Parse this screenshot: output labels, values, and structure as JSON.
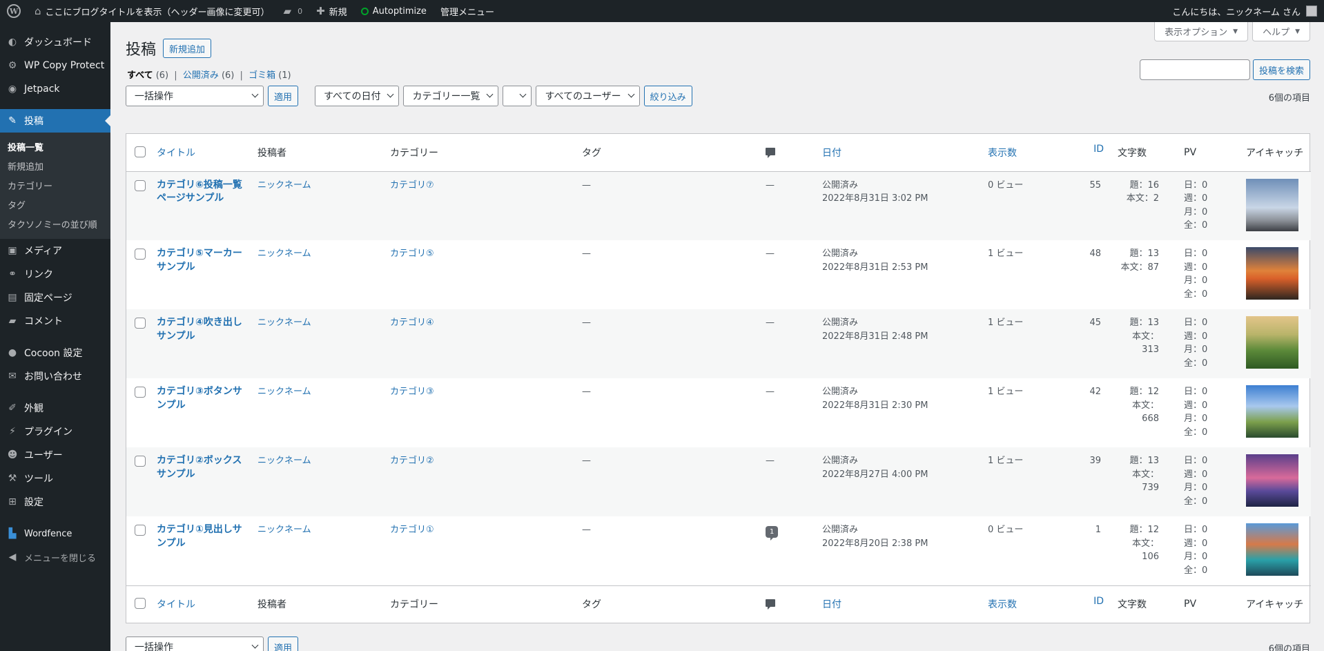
{
  "adminbar": {
    "site_title": "ここにブログタイトルを表示（ヘッダー画像に変更可）",
    "comments_count": "0",
    "new_label": "新規",
    "autoptimize_label": "Autoptimize",
    "admin_menu_label": "管理メニュー",
    "greeting": "こんにちは、ニックネーム さん"
  },
  "sidebar": {
    "items": [
      {
        "label": "ダッシュボード",
        "icon": "dashboard-icon"
      },
      {
        "label": "WP Copy Protect",
        "icon": "gear-icon"
      },
      {
        "label": "Jetpack",
        "icon": "jetpack-icon"
      },
      {
        "label": "投稿",
        "icon": "pin-icon"
      },
      {
        "label": "メディア",
        "icon": "media-icon"
      },
      {
        "label": "リンク",
        "icon": "link-icon"
      },
      {
        "label": "固定ページ",
        "icon": "page-icon"
      },
      {
        "label": "コメント",
        "icon": "comment-icon"
      },
      {
        "label": "Cocoon 設定",
        "icon": "cocoon-icon"
      },
      {
        "label": "お問い合わせ",
        "icon": "mail-icon"
      },
      {
        "label": "外観",
        "icon": "brush-icon"
      },
      {
        "label": "プラグイン",
        "icon": "plugin-icon"
      },
      {
        "label": "ユーザー",
        "icon": "user-icon"
      },
      {
        "label": "ツール",
        "icon": "wrench-icon"
      },
      {
        "label": "設定",
        "icon": "settings-icon"
      },
      {
        "label": "Wordfence",
        "icon": "wordfence-icon"
      },
      {
        "label": "メニューを閉じる",
        "icon": "collapse-icon"
      }
    ],
    "submenu": [
      "投稿一覧",
      "新規追加",
      "カテゴリー",
      "タグ",
      "タクソノミーの並び順"
    ]
  },
  "screen_options": "表示オプション",
  "help": "ヘルプ",
  "page_title": "投稿",
  "add_new": "新規追加",
  "views": {
    "all": "すべて",
    "all_count": "(6)",
    "published": "公開済み",
    "published_count": "(6)",
    "trash": "ゴミ箱",
    "trash_count": "(1)"
  },
  "search_button": "投稿を検索",
  "filters": {
    "bulk": "一括操作",
    "apply": "適用",
    "date": "すべての日付",
    "category": "カテゴリー一覧",
    "blank": "",
    "user": "すべてのユーザー",
    "filter": "絞り込み"
  },
  "items_count": "6個の項目",
  "columns": {
    "title": "タイトル",
    "author": "投稿者",
    "categories": "カテゴリー",
    "tags": "タグ",
    "date": "日付",
    "views": "表示数",
    "id": "ID",
    "chars": "文字数",
    "pv": "PV",
    "eyecatch": "アイキャッチ"
  },
  "posts": [
    {
      "title": "カテゴリ⑥投稿一覧ページサンプル",
      "author": "ニックネーム",
      "category": "カテゴリ⑦",
      "tags": "—",
      "comments": "—",
      "status": "公開済み",
      "date": "2022年8月31日 3:02 PM",
      "views": "0 ビュー",
      "id": "55",
      "title_chars": "題：16",
      "body_chars": "本文：2",
      "pv_day": "日：0",
      "pv_week": "週：0",
      "pv_month": "月：0",
      "pv_all": "全：0"
    },
    {
      "title": "カテゴリ⑤マーカーサンプル",
      "author": "ニックネーム",
      "category": "カテゴリ⑤",
      "tags": "—",
      "comments": "—",
      "status": "公開済み",
      "date": "2022年8月31日 2:53 PM",
      "views": "1 ビュー",
      "id": "48",
      "title_chars": "題：13",
      "body_chars": "本文：87",
      "pv_day": "日：0",
      "pv_week": "週：0",
      "pv_month": "月：0",
      "pv_all": "全：0"
    },
    {
      "title": "カテゴリ④吹き出しサンプル",
      "author": "ニックネーム",
      "category": "カテゴリ④",
      "tags": "—",
      "comments": "—",
      "status": "公開済み",
      "date": "2022年8月31日 2:48 PM",
      "views": "1 ビュー",
      "id": "45",
      "title_chars": "題：13",
      "body_chars": "本文：313",
      "pv_day": "日：0",
      "pv_week": "週：0",
      "pv_month": "月：0",
      "pv_all": "全：0"
    },
    {
      "title": "カテゴリ③ボタンサンプル",
      "author": "ニックネーム",
      "category": "カテゴリ③",
      "tags": "—",
      "comments": "—",
      "status": "公開済み",
      "date": "2022年8月31日 2:30 PM",
      "views": "1 ビュー",
      "id": "42",
      "title_chars": "題：12",
      "body_chars": "本文：668",
      "pv_day": "日：0",
      "pv_week": "週：0",
      "pv_month": "月：0",
      "pv_all": "全：0"
    },
    {
      "title": "カテゴリ②ボックスサンプル",
      "author": "ニックネーム",
      "category": "カテゴリ②",
      "tags": "—",
      "comments": "—",
      "status": "公開済み",
      "date": "2022年8月27日 4:00 PM",
      "views": "1 ビュー",
      "id": "39",
      "title_chars": "題：13",
      "body_chars": "本文：739",
      "pv_day": "日：0",
      "pv_week": "週：0",
      "pv_month": "月：0",
      "pv_all": "全：0"
    },
    {
      "title": "カテゴリ①見出しサンプル",
      "author": "ニックネーム",
      "category": "カテゴリ①",
      "tags": "—",
      "comments": "1",
      "status": "公開済み",
      "date": "2022年8月20日 2:38 PM",
      "views": "0 ビュー",
      "id": "1",
      "title_chars": "題：12",
      "body_chars": "本文：106",
      "pv_day": "日：0",
      "pv_week": "週：0",
      "pv_month": "月：0",
      "pv_all": "全：0"
    }
  ]
}
